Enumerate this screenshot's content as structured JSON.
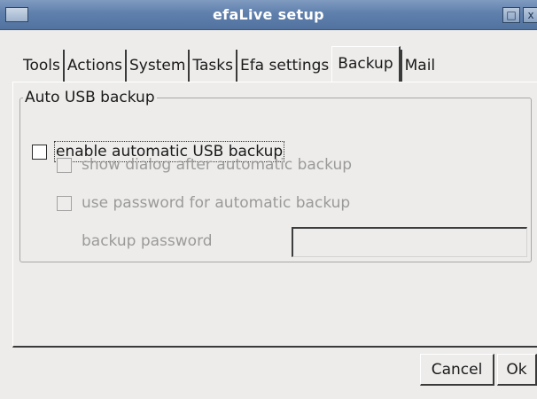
{
  "window": {
    "title": "efaLive setup"
  },
  "titlebar_icons": {
    "menu": "window-menu-icon",
    "maximize": "maximize-icon",
    "close": "close-icon",
    "close_glyph": "x"
  },
  "tabs": [
    {
      "label": "Tools",
      "selected": false
    },
    {
      "label": "Actions",
      "selected": false
    },
    {
      "label": "System",
      "selected": false
    },
    {
      "label": "Tasks",
      "selected": false
    },
    {
      "label": "Efa settings",
      "selected": false
    },
    {
      "label": "Backup",
      "selected": true
    },
    {
      "label": "Mail",
      "selected": false
    }
  ],
  "backup": {
    "group_title": "Auto USB backup",
    "enable_label": "enable automatic USB backup",
    "enable_checked": false,
    "show_dialog_label": "show dialog after automatic backup",
    "show_dialog_checked": false,
    "use_password_label": "use password for automatic backup",
    "use_password_checked": false,
    "password_label": "backup password",
    "password_value": ""
  },
  "buttons": {
    "cancel": "Cancel",
    "ok": "Ok"
  },
  "colors": {
    "titlebar": "#5f7fac",
    "window_bg": "#edeceb",
    "disabled_text": "#9a9a98"
  }
}
